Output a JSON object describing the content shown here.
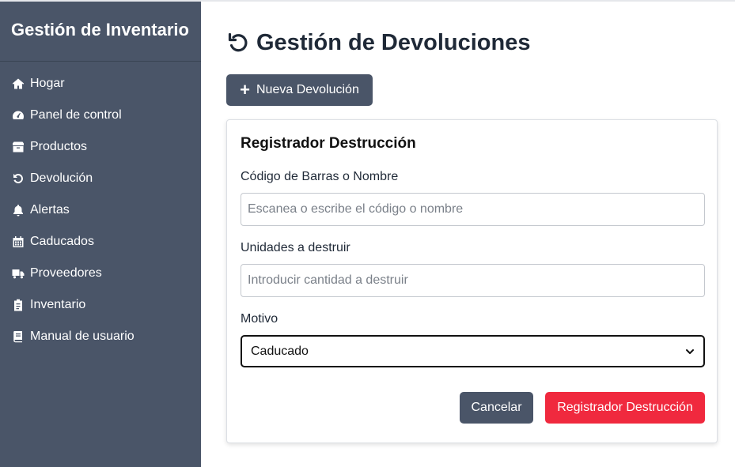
{
  "sidebar": {
    "brand": "Gestión de Inventario",
    "items": [
      {
        "label": "Hogar",
        "icon": "home-icon"
      },
      {
        "label": "Panel de control",
        "icon": "gauge-icon"
      },
      {
        "label": "Productos",
        "icon": "box-icon"
      },
      {
        "label": "Devolución",
        "icon": "undo-icon"
      },
      {
        "label": "Alertas",
        "icon": "bell-icon"
      },
      {
        "label": "Caducados",
        "icon": "calendar-icon"
      },
      {
        "label": "Proveedores",
        "icon": "truck-icon"
      },
      {
        "label": "Inventario",
        "icon": "clipboard-icon"
      },
      {
        "label": "Manual de usuario",
        "icon": "book-icon"
      }
    ]
  },
  "header": {
    "title": "Gestión de Devoluciones",
    "title_icon": "undo-icon",
    "new_button_label": "Nueva Devolución"
  },
  "form": {
    "title": "Registrador Destrucción",
    "barcode_label": "Código de Barras o Nombre",
    "barcode_placeholder": "Escanea o escribe el código o nombre",
    "barcode_value": "",
    "units_label": "Unidades a destruir",
    "units_placeholder": "Introducir cantidad a destruir",
    "units_value": "",
    "reason_label": "Motivo",
    "reason_selected": "Caducado",
    "cancel_label": "Cancelar",
    "submit_label": "Registrador Destrucción"
  },
  "colors": {
    "sidebar_bg": "#4a5568",
    "primary_dark": "#4a5568",
    "danger": "#f0293e"
  }
}
